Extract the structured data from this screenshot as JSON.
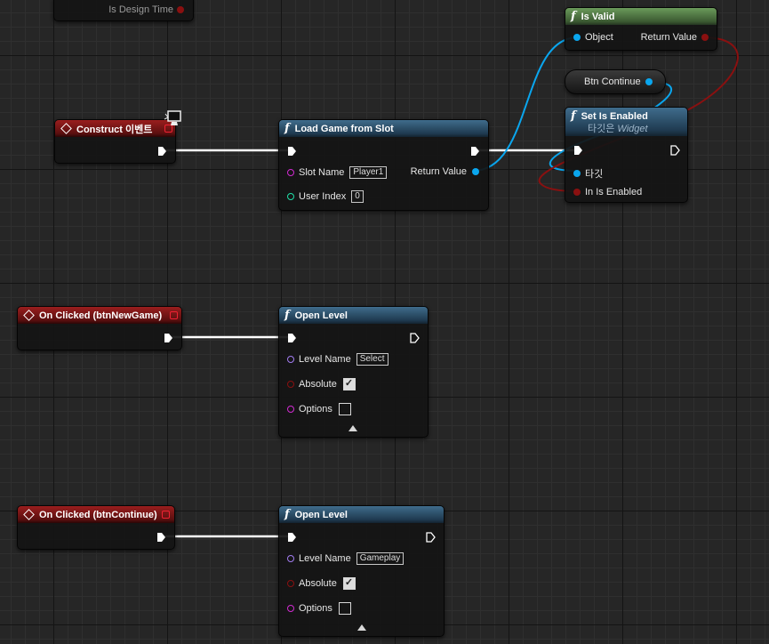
{
  "top_node": {
    "pin_label": "Is Design Time"
  },
  "is_valid": {
    "title": "Is Valid",
    "object_label": "Object",
    "return_label": "Return Value"
  },
  "btn_continue": {
    "label": "Btn Continue"
  },
  "set_enabled": {
    "title": "Set Is Enabled",
    "subtitle_prefix": "타깃은 ",
    "subtitle_target": "Widget",
    "target_label": "타깃",
    "in_enabled_label": "In Is Enabled"
  },
  "construct": {
    "title": "Construct 이벤트"
  },
  "load_game": {
    "title": "Load Game from Slot",
    "slot_label": "Slot Name",
    "slot_value": "Player1",
    "user_label": "User Index",
    "user_value": "0",
    "return_label": "Return Value"
  },
  "new_game_event": {
    "title": "On Clicked (btnNewGame)"
  },
  "open_level_1": {
    "title": "Open Level",
    "level_label": "Level Name",
    "level_value": "Select",
    "absolute_label": "Absolute",
    "absolute_checked": true,
    "options_label": "Options"
  },
  "continue_event": {
    "title": "On Clicked (btnContinue)"
  },
  "open_level_2": {
    "title": "Open Level",
    "level_label": "Level Name",
    "level_value": "Gameplay",
    "absolute_label": "Absolute",
    "absolute_checked": true,
    "options_label": "Options"
  },
  "colors": {
    "exec": "#ffffff",
    "object": "#0aa6ee",
    "bool": "#8a1010",
    "string": "#d12bd1",
    "int": "#1fe0a8",
    "name": "#a27cf0",
    "event_header": "#8b1a1a",
    "func_header": "#2c5470",
    "pure_header": "#4d7a42"
  }
}
